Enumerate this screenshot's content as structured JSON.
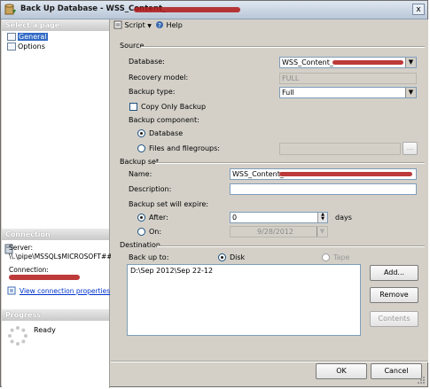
{
  "window": {
    "title": "Back Up Database - WSS_Content_",
    "close": "x"
  },
  "left": {
    "select_page_header": "Select a page",
    "pages": [
      {
        "label": "General"
      },
      {
        "label": "Options"
      }
    ],
    "connection_header": "Connection",
    "server_label": "Server:",
    "server_value": "\\\\.\\pipe\\MSSQL$MICROSOFT##",
    "connection_label": "Connection:",
    "view_props_link": "View connection properties",
    "progress_header": "Progress",
    "progress_status": "Ready"
  },
  "toolbar": {
    "script_label": "Script",
    "help_label": "Help"
  },
  "source": {
    "section_label": "Source",
    "database_label": "Database:",
    "database_value": "WSS_Content_",
    "recovery_label": "Recovery model:",
    "recovery_value": "FULL",
    "backup_type_label": "Backup type:",
    "backup_type_value": "Full",
    "copy_only_label": "Copy Only Backup",
    "component_label": "Backup component:",
    "component_database": "Database",
    "component_files": "Files and filegroups:",
    "files_browse": "..."
  },
  "backup_set": {
    "section_label": "Backup set",
    "name_label": "Name:",
    "name_value": "WSS_Content_",
    "description_label": "Description:",
    "description_value": "",
    "expire_label": "Backup set will expire:",
    "after_label": "After:",
    "after_value": "0",
    "days_label": "days",
    "on_label": "On:",
    "on_value": "9/28/2012"
  },
  "destination": {
    "section_label": "Destination",
    "back_up_to_label": "Back up to:",
    "disk_label": "Disk",
    "tape_label": "Tape",
    "paths": [
      "D:\\Sep 2012\\Sep 22-12"
    ],
    "add_button": "Add...",
    "remove_button": "Remove",
    "contents_button": "Contents"
  },
  "footer": {
    "ok_button": "OK",
    "cancel_button": "Cancel"
  }
}
